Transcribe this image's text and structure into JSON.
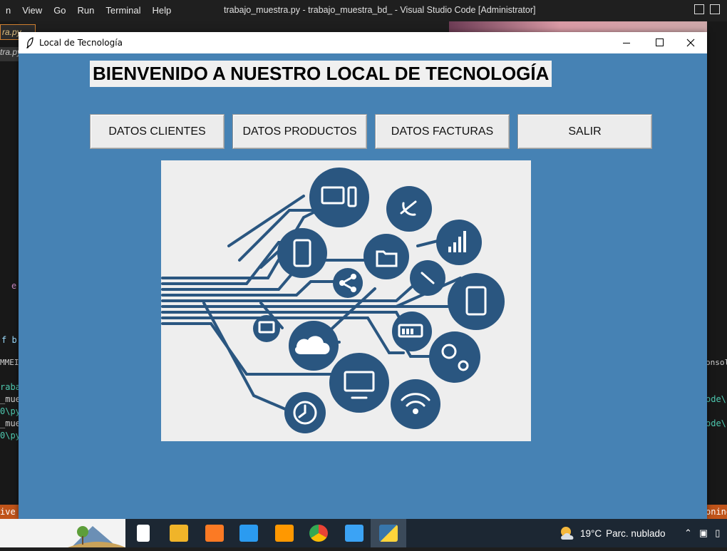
{
  "vscode": {
    "menu": [
      "n",
      "View",
      "Go",
      "Run",
      "Terminal",
      "Help"
    ],
    "window_title": "trabajo_muestra.py - trabajo_muestra_bd_ - Visual Studio Code [Administrator]",
    "left_tab": "ra.py",
    "left_tab2": "tra.py",
    "frag_e": "e",
    "frag_fb": "f b",
    "frag_mme": "MMEI",
    "frag_lines": [
      "raba",
      "_mue",
      "0\\py",
      "_mue",
      "0\\py"
    ],
    "frag_console": "onsole",
    "frag_ode1": "ode\\",
    "frag_ode2": "ode\\",
    "status_left": "ive S",
    "status_right": "onine"
  },
  "app": {
    "title": "Local de Tecnología",
    "welcome": "BIENVENIDO A NUESTRO LOCAL DE TECNOLOGÍA",
    "buttons": {
      "clientes": "DATOS CLIENTES",
      "productos": "DATOS PRODUCTOS",
      "facturas": "DATOS FACTURAS",
      "salir": "SALIR"
    },
    "colors": {
      "background": "#4682b4",
      "illustration_ink": "#2a5680",
      "illustration_bg": "#eeeeee"
    }
  },
  "taskbar": {
    "pinned": [
      "file-icon",
      "file-explorer-icon",
      "xampp-icon",
      "vscode-icon",
      "sublime-icon",
      "chrome-icon",
      "photos-icon",
      "python-icon"
    ],
    "weather_temp": "19°C",
    "weather_desc": "Parc. nublado"
  }
}
